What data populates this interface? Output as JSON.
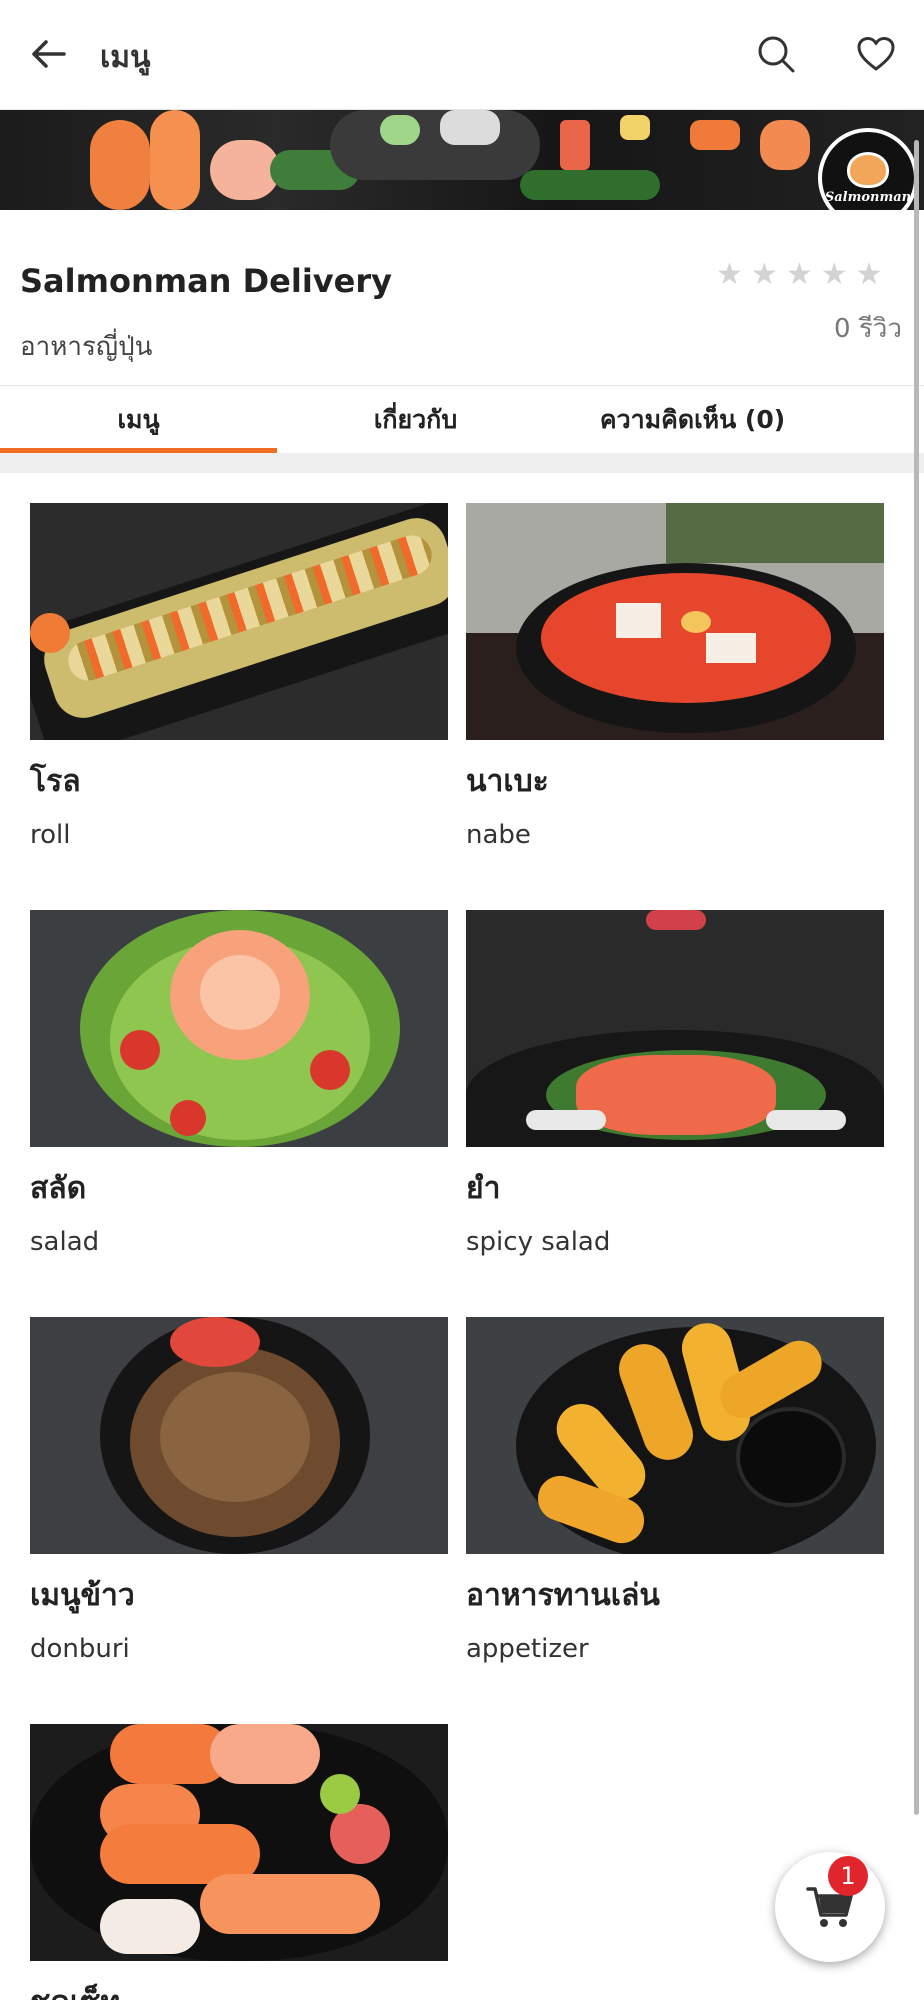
{
  "appbar": {
    "title": "เมนู"
  },
  "store": {
    "name": "Salmonman Delivery",
    "cuisine": "อาหารญี่ปุ่น",
    "rating_stars": 0,
    "reviews": "0 รีวิว",
    "logo_text": "Salmonman"
  },
  "tabs": [
    {
      "label": "เมนู",
      "active": true
    },
    {
      "label": "เกี่ยวกับ",
      "active": false
    },
    {
      "label": "ความคิดเห็น (0)",
      "active": false
    }
  ],
  "menu": [
    {
      "th": "โรล",
      "en": "roll"
    },
    {
      "th": "นาเบะ",
      "en": "nabe"
    },
    {
      "th": "สลัด",
      "en": "salad"
    },
    {
      "th": "ยำ",
      "en": "spicy salad"
    },
    {
      "th": "เมนูข้าว",
      "en": "donburi"
    },
    {
      "th": "อาหารทานเล่น",
      "en": "appetizer"
    },
    {
      "th": "ชุดเซ็ท",
      "en": ""
    }
  ],
  "cart": {
    "count": "1"
  },
  "colors": {
    "accent": "#f26d21",
    "badge": "#e0262c"
  }
}
